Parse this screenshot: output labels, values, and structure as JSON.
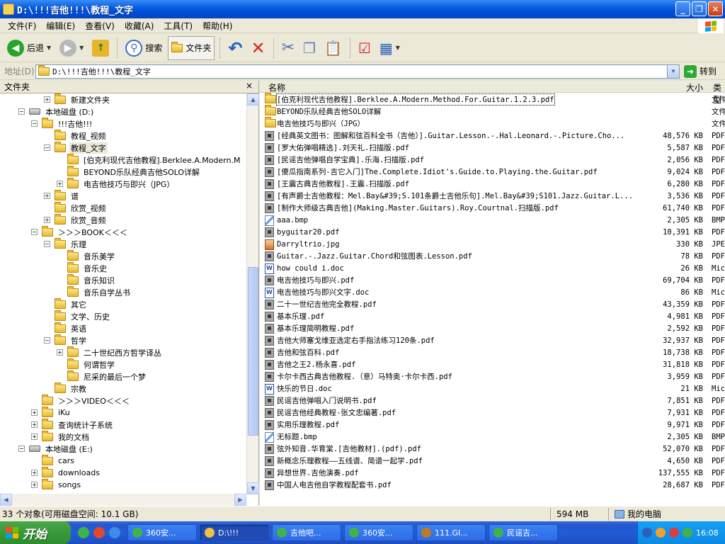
{
  "window": {
    "title": "D:\\!!!吉他!!!\\教程_文字"
  },
  "menu": [
    "文件(F)",
    "编辑(E)",
    "查看(V)",
    "收藏(A)",
    "工具(T)",
    "帮助(H)"
  ],
  "toolbar": {
    "back_label": "后退",
    "search_label": "搜索",
    "folders_label": "文件夹"
  },
  "address": {
    "label": "地址(D)",
    "value": "D:\\!!!吉他!!!\\教程_文字",
    "go_label": "转到"
  },
  "left_pane": {
    "title": "文件夹",
    "close": "×",
    "tree": [
      {
        "label": "新建文件夹",
        "level": 3,
        "expander": "+",
        "icon": "folder"
      },
      {
        "label": "本地磁盘 (D:)",
        "level": 1,
        "expander": "-",
        "icon": "drive"
      },
      {
        "label": "!!!吉他!!!",
        "level": 2,
        "expander": "-",
        "icon": "folder"
      },
      {
        "label": "教程_视频",
        "level": 3,
        "expander": "",
        "icon": "folder"
      },
      {
        "label": "教程_文字",
        "level": 3,
        "expander": "-",
        "icon": "folder",
        "selected": true
      },
      {
        "label": "[伯克利现代吉他教程].Berklee.A.Modern.M",
        "level": 4,
        "expander": "",
        "icon": "folder"
      },
      {
        "label": "BEYOND乐队经典吉他SOLO详解",
        "level": 4,
        "expander": "",
        "icon": "folder"
      },
      {
        "label": "电吉他技巧与即兴（JPG）",
        "level": 4,
        "expander": "+",
        "icon": "folder"
      },
      {
        "label": "谱",
        "level": 3,
        "expander": "+",
        "icon": "folder"
      },
      {
        "label": "欣赏_视频",
        "level": 3,
        "expander": "",
        "icon": "folder"
      },
      {
        "label": "欣赏_音频",
        "level": 3,
        "expander": "+",
        "icon": "folder"
      },
      {
        "label": "＞＞＞BOOK＜＜＜",
        "level": 2,
        "expander": "-",
        "icon": "folder"
      },
      {
        "label": "乐理",
        "level": 3,
        "expander": "-",
        "icon": "folder"
      },
      {
        "label": "音乐美学",
        "level": 4,
        "expander": "",
        "icon": "folder"
      },
      {
        "label": "音乐史",
        "level": 4,
        "expander": "",
        "icon": "folder"
      },
      {
        "label": "音乐知识",
        "level": 4,
        "expander": "",
        "icon": "folder"
      },
      {
        "label": "音乐自学丛书",
        "level": 4,
        "expander": "",
        "icon": "folder"
      },
      {
        "label": "其它",
        "level": 3,
        "expander": "",
        "icon": "folder"
      },
      {
        "label": "文学、历史",
        "level": 3,
        "expander": "",
        "icon": "folder"
      },
      {
        "label": "英语",
        "level": 3,
        "expander": "",
        "icon": "folder"
      },
      {
        "label": "哲学",
        "level": 3,
        "expander": "-",
        "icon": "folder"
      },
      {
        "label": "二十世纪西方哲学译丛",
        "level": 4,
        "expander": "+",
        "icon": "folder"
      },
      {
        "label": "何谓哲学",
        "level": 4,
        "expander": "",
        "icon": "folder"
      },
      {
        "label": "尼采的最后一个梦",
        "level": 4,
        "expander": "",
        "icon": "folder"
      },
      {
        "label": "宗教",
        "level": 3,
        "expander": "",
        "icon": "folder"
      },
      {
        "label": "＞＞＞VIDEO＜＜＜",
        "level": 2,
        "expander": "",
        "icon": "folder"
      },
      {
        "label": "iKu",
        "level": 2,
        "expander": "+",
        "icon": "folder"
      },
      {
        "label": "查询统计子系统",
        "level": 2,
        "expander": "+",
        "icon": "folder"
      },
      {
        "label": "我的文档",
        "level": 2,
        "expander": "+",
        "icon": "folder"
      },
      {
        "label": "本地磁盘 (E:)",
        "level": 1,
        "expander": "-",
        "icon": "drive"
      },
      {
        "label": "cars",
        "level": 2,
        "expander": "",
        "icon": "folder"
      },
      {
        "label": "downloads",
        "level": 2,
        "expander": "+",
        "icon": "folder"
      },
      {
        "label": "songs",
        "level": 2,
        "expander": "+",
        "icon": "folder"
      }
    ]
  },
  "file_list": {
    "columns": {
      "name": "名称",
      "size": "大小",
      "type": "类型"
    },
    "rows": [
      {
        "name": "[伯克利现代吉他教程].Berklee.A.Modern.Method.For.Guitar.1.2.3.pdf",
        "size": "",
        "type": "文件",
        "icon": "folder"
      },
      {
        "name": "BEYOND乐队经典吉他SOLO详解",
        "size": "",
        "type": "文件",
        "icon": "folder"
      },
      {
        "name": "电吉他技巧与即兴（JPG）",
        "size": "",
        "type": "文件",
        "icon": "folder"
      },
      {
        "name": "[经典英文图书：图解和弦百科全书（吉他）].Guitar.Lesson.-.Hal.Leonard.-.Picture.Cho...",
        "size": "48,576 KB",
        "type": "PDF",
        "icon": "pdf"
      },
      {
        "name": "[罗大佑弹唱精选].刘天礼.扫描版.pdf",
        "size": "5,587 KB",
        "type": "PDF",
        "icon": "pdf"
      },
      {
        "name": "[民谣吉他弹唱自学宝典].乐海.扫描版.pdf",
        "size": "2,056 KB",
        "type": "PDF",
        "icon": "pdf"
      },
      {
        "name": "[傻瓜指南系列-吉它入门]The.Complete.Idiot's.Guide.to.Playing.the.Guitar.pdf",
        "size": "9,024 KB",
        "type": "PDF",
        "icon": "pdf"
      },
      {
        "name": "[王震古典吉他教程].王震.扫描版.pdf",
        "size": "6,280 KB",
        "type": "PDF",
        "icon": "pdf"
      },
      {
        "name": "[有声爵士吉他教程：Mel.Bay&#39;S.101条爵士吉他乐句].Mel.Bay&#39;S101.Jazz.Guitar.L...",
        "size": "3,536 KB",
        "type": "PDF",
        "icon": "pdf"
      },
      {
        "name": "[制作大师级古典吉他](Making.Master.Guitars).Roy.Courtnal.扫描版.pdf",
        "size": "61,740 KB",
        "type": "PDF",
        "icon": "pdf"
      },
      {
        "name": "aaa.bmp",
        "size": "2,305 KB",
        "type": "BMP",
        "icon": "bmp"
      },
      {
        "name": "byguitar20.pdf",
        "size": "10,391 KB",
        "type": "PDF",
        "icon": "pdf"
      },
      {
        "name": "Darryltrio.jpg",
        "size": "330 KB",
        "type": "JPE",
        "icon": "jpg"
      },
      {
        "name": "Guitar.-.Jazz.Guitar.Chord和弦图表.Lesson.pdf",
        "size": "78 KB",
        "type": "PDF",
        "icon": "pdf"
      },
      {
        "name": "how could i.doc",
        "size": "26 KB",
        "type": "Mic",
        "icon": "doc"
      },
      {
        "name": "电吉他技巧与即兴.pdf",
        "size": "69,704 KB",
        "type": "PDF",
        "icon": "pdf"
      },
      {
        "name": "电吉他技巧与即兴文字.doc",
        "size": "86 KB",
        "type": "Mic",
        "icon": "doc"
      },
      {
        "name": "二十一世纪吉他完全教程.pdf",
        "size": "43,359 KB",
        "type": "PDF",
        "icon": "pdf"
      },
      {
        "name": "基本乐理.pdf",
        "size": "4,981 KB",
        "type": "PDF",
        "icon": "pdf"
      },
      {
        "name": "基本乐理简明教程.pdf",
        "size": "2,592 KB",
        "type": "PDF",
        "icon": "pdf"
      },
      {
        "name": "吉他大师塞戈维亚选定右手指法练习120条.pdf",
        "size": "32,937 KB",
        "type": "PDF",
        "icon": "pdf"
      },
      {
        "name": "吉他和弦百科.pdf",
        "size": "18,738 KB",
        "type": "PDF",
        "icon": "pdf"
      },
      {
        "name": "吉他之王2.杨永喜.pdf",
        "size": "31,818 KB",
        "type": "PDF",
        "icon": "pdf"
      },
      {
        "name": "卡尔卡西古典吉他教程.（意）马特奥·卡尔卡西.pdf",
        "size": "3,959 KB",
        "type": "PDF",
        "icon": "pdf"
      },
      {
        "name": "快乐的节日.doc",
        "size": "21 KB",
        "type": "Mic",
        "icon": "doc"
      },
      {
        "name": "民谣吉他弹唱入门说明书.pdf",
        "size": "7,851 KB",
        "type": "PDF",
        "icon": "pdf"
      },
      {
        "name": "民谣吉他经典教程-张文忠编著.pdf",
        "size": "7,931 KB",
        "type": "PDF",
        "icon": "pdf"
      },
      {
        "name": "实用乐理教程.pdf",
        "size": "9,971 KB",
        "type": "PDF",
        "icon": "pdf"
      },
      {
        "name": "无标题.bmp",
        "size": "2,305 KB",
        "type": "BMP",
        "icon": "bmp"
      },
      {
        "name": "弦外知音.华育棠.[吉他教材].(pdf).pdf",
        "size": "52,070 KB",
        "type": "PDF",
        "icon": "pdf"
      },
      {
        "name": "新概念乐理教程——五线谱、简谱一起学.pdf",
        "size": "4,650 KB",
        "type": "PDF",
        "icon": "pdf"
      },
      {
        "name": "异想世界.吉他演奏.pdf",
        "size": "137,555 KB",
        "type": "PDF",
        "icon": "pdf"
      },
      {
        "name": "中国人电吉他自学教程配套书.pdf",
        "size": "28,687 KB",
        "type": "PDF",
        "icon": "pdf"
      }
    ]
  },
  "status": {
    "objects": "33 个对象(可用磁盘空间: 10.1 GB)",
    "size": "594 MB",
    "location": "我的电脑"
  },
  "taskbar": {
    "start_label": "开始",
    "tasks": [
      "360安...",
      "D:\\!!!",
      "吉他吧...",
      "360安...",
      "111.GI...",
      "民谣吉..."
    ],
    "active_task": 1,
    "clock": "16:08"
  },
  "colors": {
    "titlebar": "#0a5ee0",
    "taskbar": "#245edb",
    "start": "#3c9b3c"
  }
}
